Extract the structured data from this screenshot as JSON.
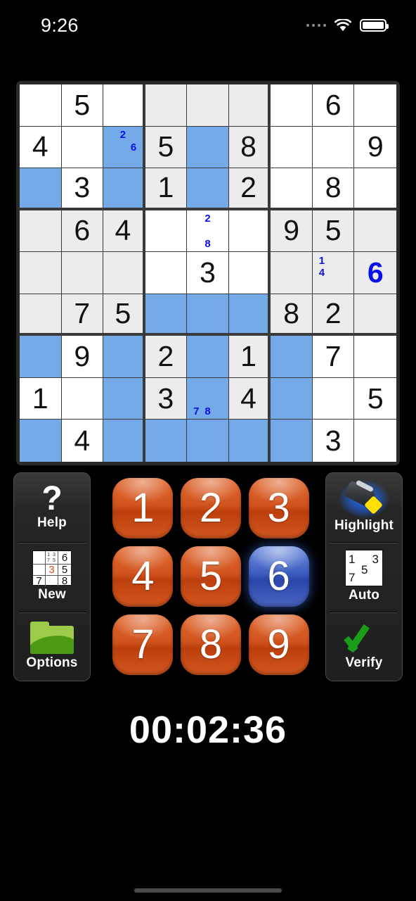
{
  "statusbar": {
    "time": "9:26",
    "signal_icon": "signal-dots-icon",
    "wifi_icon": "wifi-icon",
    "battery_icon": "battery-full-icon"
  },
  "board": {
    "rows": 9,
    "cols": 9,
    "colors": {
      "cell_white": "#ffffff",
      "cell_shaded": "#ececec",
      "cell_highlight": "#74aae8",
      "given_value": "#111111",
      "user_value": "#0a11e8",
      "note": "#0a11e8",
      "grid_line": "#3a3a3a"
    },
    "cells": [
      [
        {
          "v": "",
          "s": 0,
          "h": 0,
          "n": []
        },
        {
          "v": "5",
          "s": 0,
          "h": 0,
          "n": []
        },
        {
          "v": "",
          "s": 0,
          "h": 0,
          "n": []
        },
        {
          "v": "",
          "s": 1,
          "h": 0,
          "n": []
        },
        {
          "v": "",
          "s": 1,
          "h": 0,
          "n": []
        },
        {
          "v": "",
          "s": 1,
          "h": 0,
          "n": []
        },
        {
          "v": "",
          "s": 0,
          "h": 0,
          "n": []
        },
        {
          "v": "6",
          "s": 0,
          "h": 0,
          "n": []
        },
        {
          "v": "",
          "s": 0,
          "h": 0,
          "n": []
        }
      ],
      [
        {
          "v": "4",
          "s": 0,
          "h": 0,
          "n": []
        },
        {
          "v": "",
          "s": 0,
          "h": 0,
          "n": []
        },
        {
          "v": "",
          "s": 0,
          "h": 1,
          "n": [
            2,
            6
          ]
        },
        {
          "v": "5",
          "s": 1,
          "h": 0,
          "n": []
        },
        {
          "v": "",
          "s": 1,
          "h": 1,
          "n": []
        },
        {
          "v": "8",
          "s": 1,
          "h": 0,
          "n": []
        },
        {
          "v": "",
          "s": 0,
          "h": 0,
          "n": []
        },
        {
          "v": "",
          "s": 0,
          "h": 0,
          "n": []
        },
        {
          "v": "9",
          "s": 0,
          "h": 0,
          "n": []
        }
      ],
      [
        {
          "v": "",
          "s": 0,
          "h": 1,
          "n": []
        },
        {
          "v": "3",
          "s": 0,
          "h": 0,
          "n": []
        },
        {
          "v": "",
          "s": 0,
          "h": 1,
          "n": []
        },
        {
          "v": "1",
          "s": 1,
          "h": 0,
          "n": []
        },
        {
          "v": "",
          "s": 1,
          "h": 1,
          "n": []
        },
        {
          "v": "2",
          "s": 1,
          "h": 0,
          "n": []
        },
        {
          "v": "",
          "s": 0,
          "h": 0,
          "n": []
        },
        {
          "v": "8",
          "s": 0,
          "h": 0,
          "n": []
        },
        {
          "v": "",
          "s": 0,
          "h": 0,
          "n": []
        }
      ],
      [
        {
          "v": "",
          "s": 1,
          "h": 0,
          "n": []
        },
        {
          "v": "6",
          "s": 1,
          "h": 0,
          "n": []
        },
        {
          "v": "4",
          "s": 1,
          "h": 0,
          "n": []
        },
        {
          "v": "",
          "s": 0,
          "h": 0,
          "n": []
        },
        {
          "v": "",
          "s": 0,
          "h": 0,
          "n": [
            2,
            8
          ]
        },
        {
          "v": "",
          "s": 0,
          "h": 0,
          "n": []
        },
        {
          "v": "9",
          "s": 1,
          "h": 0,
          "n": []
        },
        {
          "v": "5",
          "s": 1,
          "h": 0,
          "n": []
        },
        {
          "v": "",
          "s": 1,
          "h": 0,
          "n": []
        }
      ],
      [
        {
          "v": "",
          "s": 1,
          "h": 0,
          "n": []
        },
        {
          "v": "",
          "s": 1,
          "h": 0,
          "n": []
        },
        {
          "v": "",
          "s": 1,
          "h": 0,
          "n": []
        },
        {
          "v": "",
          "s": 0,
          "h": 0,
          "n": []
        },
        {
          "v": "3",
          "s": 0,
          "h": 0,
          "n": []
        },
        {
          "v": "",
          "s": 0,
          "h": 0,
          "n": []
        },
        {
          "v": "",
          "s": 1,
          "h": 0,
          "n": []
        },
        {
          "v": "",
          "s": 1,
          "h": 0,
          "n": [
            1,
            4
          ]
        },
        {
          "v": "6",
          "s": 1,
          "h": 0,
          "u": 1,
          "n": []
        }
      ],
      [
        {
          "v": "",
          "s": 1,
          "h": 0,
          "n": []
        },
        {
          "v": "7",
          "s": 1,
          "h": 0,
          "n": []
        },
        {
          "v": "5",
          "s": 1,
          "h": 0,
          "n": []
        },
        {
          "v": "",
          "s": 0,
          "h": 1,
          "n": []
        },
        {
          "v": "",
          "s": 0,
          "h": 1,
          "n": []
        },
        {
          "v": "",
          "s": 0,
          "h": 1,
          "n": []
        },
        {
          "v": "8",
          "s": 1,
          "h": 0,
          "n": []
        },
        {
          "v": "2",
          "s": 1,
          "h": 0,
          "n": []
        },
        {
          "v": "",
          "s": 1,
          "h": 0,
          "n": []
        }
      ],
      [
        {
          "v": "",
          "s": 0,
          "h": 1,
          "n": []
        },
        {
          "v": "9",
          "s": 0,
          "h": 0,
          "n": []
        },
        {
          "v": "",
          "s": 0,
          "h": 1,
          "n": []
        },
        {
          "v": "2",
          "s": 1,
          "h": 0,
          "n": []
        },
        {
          "v": "",
          "s": 1,
          "h": 1,
          "n": []
        },
        {
          "v": "1",
          "s": 1,
          "h": 0,
          "n": []
        },
        {
          "v": "",
          "s": 0,
          "h": 1,
          "n": []
        },
        {
          "v": "7",
          "s": 0,
          "h": 0,
          "n": []
        },
        {
          "v": "",
          "s": 0,
          "h": 0,
          "n": []
        }
      ],
      [
        {
          "v": "1",
          "s": 0,
          "h": 0,
          "n": []
        },
        {
          "v": "",
          "s": 0,
          "h": 0,
          "n": []
        },
        {
          "v": "",
          "s": 0,
          "h": 1,
          "n": []
        },
        {
          "v": "3",
          "s": 1,
          "h": 0,
          "n": []
        },
        {
          "v": "",
          "s": 1,
          "h": 1,
          "n": [
            7,
            8
          ]
        },
        {
          "v": "4",
          "s": 1,
          "h": 0,
          "n": []
        },
        {
          "v": "",
          "s": 0,
          "h": 1,
          "n": []
        },
        {
          "v": "",
          "s": 0,
          "h": 0,
          "n": []
        },
        {
          "v": "5",
          "s": 0,
          "h": 0,
          "n": []
        }
      ],
      [
        {
          "v": "",
          "s": 0,
          "h": 1,
          "n": []
        },
        {
          "v": "4",
          "s": 0,
          "h": 0,
          "n": []
        },
        {
          "v": "",
          "s": 0,
          "h": 1,
          "n": []
        },
        {
          "v": "",
          "s": 1,
          "h": 1,
          "n": []
        },
        {
          "v": "",
          "s": 1,
          "h": 1,
          "n": []
        },
        {
          "v": "",
          "s": 1,
          "h": 1,
          "n": []
        },
        {
          "v": "",
          "s": 0,
          "h": 1,
          "n": []
        },
        {
          "v": "3",
          "s": 0,
          "h": 0,
          "n": []
        },
        {
          "v": "",
          "s": 0,
          "h": 0,
          "n": []
        }
      ]
    ]
  },
  "left_panel": {
    "help": {
      "label": "Help",
      "icon": "question-mark-icon"
    },
    "new": {
      "label": "New",
      "icon": "mini-sudoku-grid-icon",
      "mini_cells": [
        "",
        "notes",
        "6",
        "",
        "3",
        "5",
        "7",
        "",
        "8"
      ],
      "mini_notes": "1 3\n7 5",
      "highlight_value": "3",
      "highlight_color": "#e04a10"
    },
    "options": {
      "label": "Options",
      "icon": "folder-icon",
      "color": "#9ccb4a"
    }
  },
  "right_panel": {
    "highlight": {
      "label": "Highlight",
      "icon": "highlighter-pen-icon",
      "active": true,
      "glow_color": "#2676ff"
    },
    "auto": {
      "label": "Auto",
      "icon": "auto-notes-icon",
      "digits": [
        "1",
        "3",
        "5",
        "7"
      ]
    },
    "verify": {
      "label": "Verify",
      "icon": "green-checkmark-icon",
      "color": "#1a9e1a"
    }
  },
  "numpad": {
    "selected": "6",
    "buttons": [
      "1",
      "2",
      "3",
      "4",
      "5",
      "6",
      "7",
      "8",
      "9"
    ],
    "color_normal": "#d2541e",
    "color_selected": "#3f5fc0"
  },
  "timer": {
    "value": "00:02:36"
  },
  "home_indicator": {
    "visible": true
  }
}
